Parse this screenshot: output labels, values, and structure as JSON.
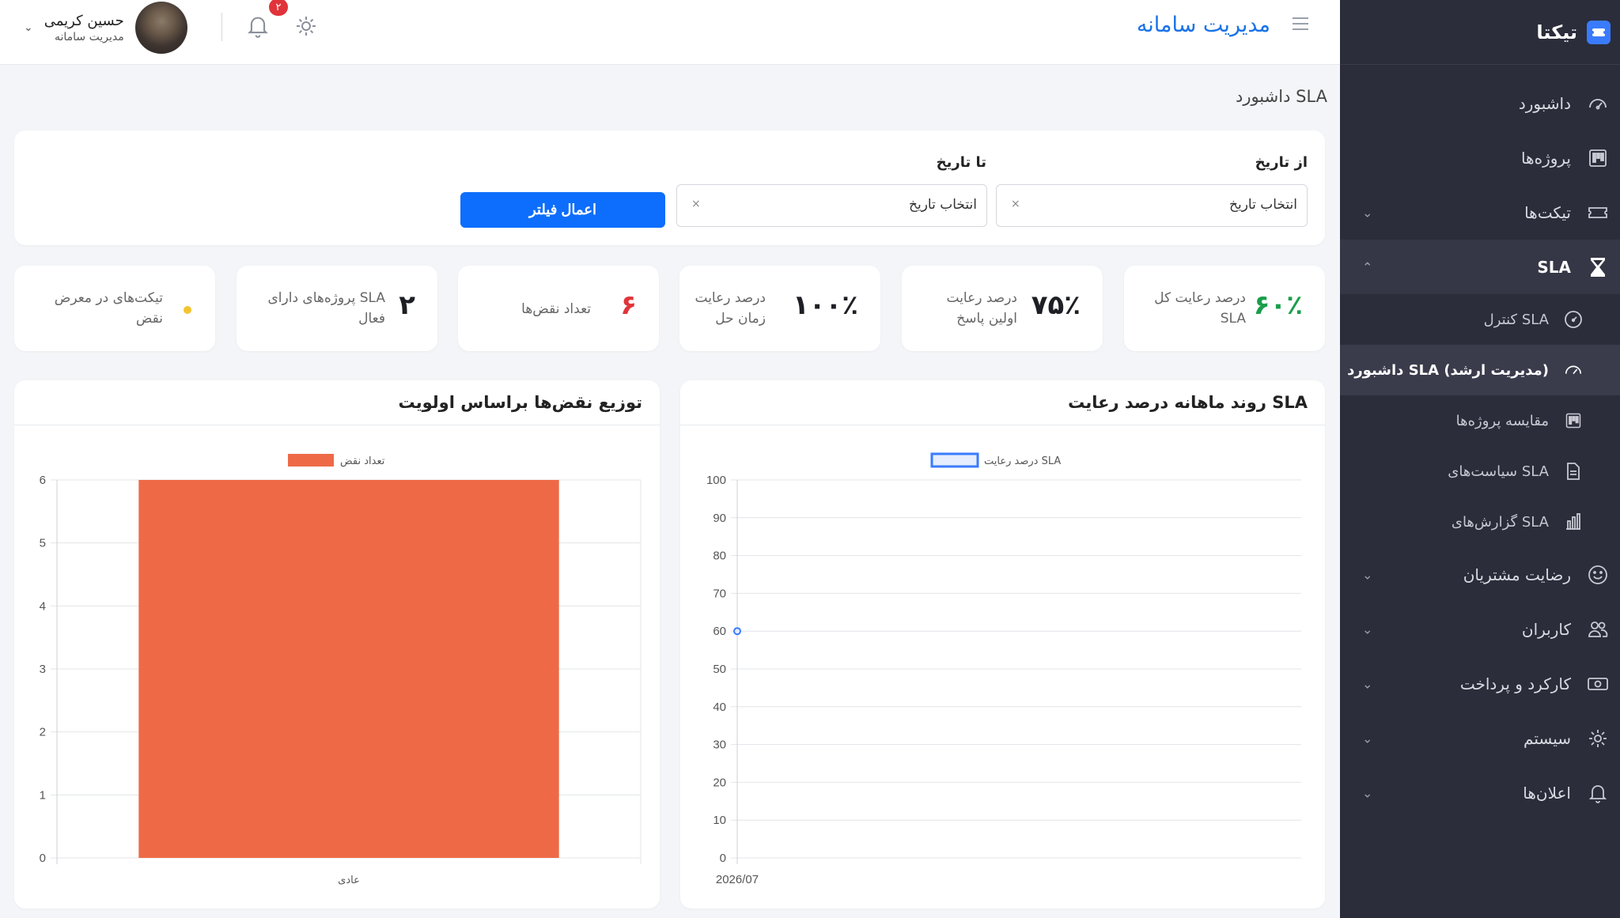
{
  "sidebar": {
    "brand": "تیکتا",
    "items": [
      {
        "label": "داشبورد"
      },
      {
        "label": "پروژه‌ها"
      },
      {
        "label": "تیکت‌ها"
      },
      {
        "label": "SLA"
      },
      {
        "label": "رضایت مشتریان"
      },
      {
        "label": "کاربران"
      },
      {
        "label": "کارکرد و پرداخت"
      },
      {
        "label": "سیستم"
      },
      {
        "label": "اعلان‌ها"
      }
    ],
    "sla_sub": [
      {
        "label": "کنترل SLA"
      },
      {
        "label": "داشبورد SLA (مدیریت ارشد)"
      },
      {
        "label": "مقایسه پروژه‌ها"
      },
      {
        "label": "سیاست‌های SLA"
      },
      {
        "label": "گزارش‌های SLA"
      }
    ]
  },
  "header": {
    "title": "مدیریت سامانه",
    "user_name": "حسین کریمی",
    "user_role": "مدیریت سامانه",
    "notification_count": "۲"
  },
  "breadcrumb": "داشبورد SLA",
  "filter": {
    "from_label": "از تاریخ",
    "to_label": "تا تاریخ",
    "from_placeholder": "انتخاب تاریخ",
    "to_placeholder": "انتخاب تاریخ",
    "clear": "×",
    "apply": "اعمال فیلتر"
  },
  "stats": [
    {
      "value": "۶۰٪",
      "label_1": "درصد رعایت کل",
      "label_2": "SLA"
    },
    {
      "value": "۷۵٪",
      "label_1": "درصد رعایت",
      "label_2": "اولین پاسخ"
    },
    {
      "value": "۱۰۰٪",
      "label_1": "درصد رعایت",
      "label_2": "زمان حل"
    },
    {
      "value": "۶",
      "label_1": "تعداد نقض‌ها",
      "label_2": ""
    },
    {
      "value": "۲",
      "label_1": "پروژه‌های دارای SLA",
      "label_2": "فعال"
    },
    {
      "value": "",
      "label_1": "تیکت‌های در معرض",
      "label_2": "نقض"
    }
  ],
  "charts": {
    "line_title": "روند ماهانه درصد رعایت SLA",
    "bar_title": "توزیع نقض‌ها براساس اولویت"
  },
  "chart_data": [
    {
      "type": "line",
      "title": "روند ماهانه درصد رعایت SLA",
      "categories": [
        "2026/07"
      ],
      "series": [
        {
          "name": "درصد رعایت SLA",
          "values": [
            60
          ]
        }
      ],
      "ylim": [
        0,
        100
      ],
      "yticks": [
        0,
        10,
        20,
        30,
        40,
        50,
        60,
        70,
        80,
        90,
        100
      ],
      "color": "#3a7bfd",
      "legend": "top"
    },
    {
      "type": "bar",
      "title": "توزیع نقض‌ها براساس اولویت",
      "categories": [
        "عادی"
      ],
      "series": [
        {
          "name": "تعداد نقض",
          "values": [
            6
          ]
        }
      ],
      "ylim": [
        0,
        6
      ],
      "yticks": [
        0,
        1,
        2,
        3,
        4,
        5,
        6
      ],
      "color": "#ee6a47",
      "legend": "top"
    }
  ]
}
